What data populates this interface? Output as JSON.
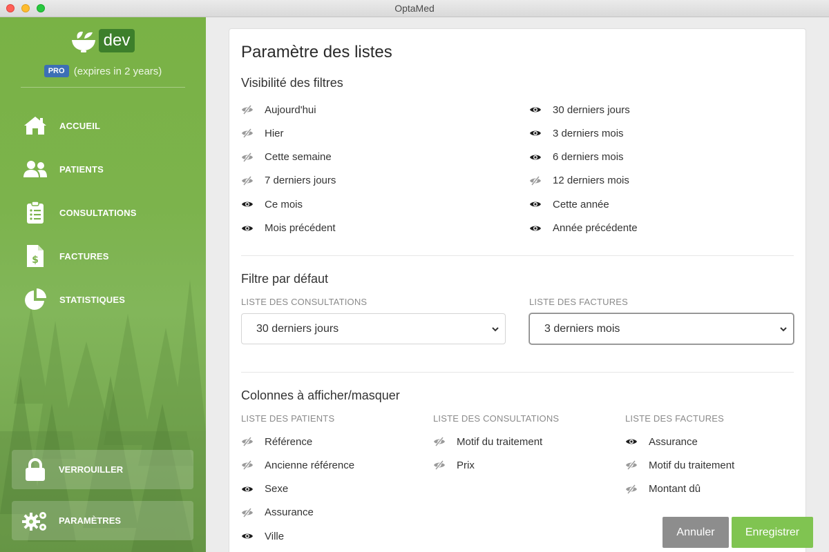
{
  "window": {
    "title": "OptaMed"
  },
  "sidebar": {
    "env_badge": "dev",
    "plan_badge": "PRO",
    "plan_expiry": "(expires in 2 years)",
    "nav": [
      {
        "label": "ACCUEIL",
        "icon": "home-icon"
      },
      {
        "label": "PATIENTS",
        "icon": "users-icon"
      },
      {
        "label": "CONSULTATIONS",
        "icon": "clipboard-list-icon"
      },
      {
        "label": "FACTURES",
        "icon": "invoice-dollar-icon"
      },
      {
        "label": "STATISTIQUES",
        "icon": "pie-chart-icon"
      }
    ],
    "lock_label": "VERROUILLER",
    "settings_label": "PARAMÈTRES"
  },
  "main": {
    "title": "Paramètre des listes",
    "filters_visibility": {
      "heading": "Visibilité des filtres",
      "left": [
        {
          "label": "Aujourd'hui",
          "visible": false
        },
        {
          "label": "Hier",
          "visible": false
        },
        {
          "label": "Cette semaine",
          "visible": false
        },
        {
          "label": "7 derniers jours",
          "visible": false
        },
        {
          "label": "Ce mois",
          "visible": true
        },
        {
          "label": "Mois précédent",
          "visible": true
        }
      ],
      "right": [
        {
          "label": "30 derniers jours",
          "visible": true
        },
        {
          "label": "3 derniers mois",
          "visible": true
        },
        {
          "label": "6 derniers mois",
          "visible": true
        },
        {
          "label": "12 derniers mois",
          "visible": false
        },
        {
          "label": "Cette année",
          "visible": true
        },
        {
          "label": "Année précédente",
          "visible": true
        }
      ]
    },
    "default_filter": {
      "heading": "Filtre par défaut",
      "consultations_label": "LISTE DES CONSULTATIONS",
      "consultations_value": "30 derniers jours",
      "invoices_label": "LISTE DES FACTURES",
      "invoices_value": "3 derniers mois"
    },
    "columns": {
      "heading": "Colonnes à afficher/masquer",
      "patients": {
        "label": "LISTE DES PATIENTS",
        "items": [
          {
            "label": "Référence",
            "visible": false
          },
          {
            "label": "Ancienne référence",
            "visible": false
          },
          {
            "label": "Sexe",
            "visible": true
          },
          {
            "label": "Assurance",
            "visible": false
          },
          {
            "label": "Ville",
            "visible": true
          }
        ]
      },
      "consultations": {
        "label": "LISTE DES CONSULTATIONS",
        "items": [
          {
            "label": "Motif du traitement",
            "visible": false
          },
          {
            "label": "Prix",
            "visible": false
          }
        ]
      },
      "invoices": {
        "label": "LISTE DES FACTURES",
        "items": [
          {
            "label": "Assurance",
            "visible": true
          },
          {
            "label": "Motif du traitement",
            "visible": false
          },
          {
            "label": "Montant dû",
            "visible": false
          }
        ]
      }
    },
    "cancel_label": "Annuler",
    "save_label": "Enregistrer"
  },
  "colors": {
    "sidebar_green": "#7cb34c",
    "dev_badge": "#3d7f2b",
    "pro_badge": "#3c6fb6",
    "save_button": "#80c451",
    "cancel_button": "#8d8d8d"
  }
}
